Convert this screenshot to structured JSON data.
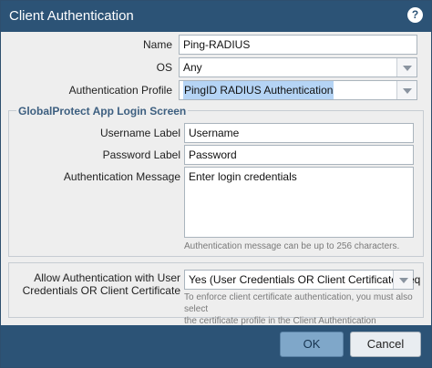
{
  "dialog": {
    "title": "Client Authentication",
    "help_icon": "?"
  },
  "form": {
    "name_label": "Name",
    "name_value": "Ping-RADIUS",
    "os_label": "OS",
    "os_value": "Any",
    "auth_profile_label": "Authentication Profile",
    "auth_profile_value": "PingID RADIUS Authentication"
  },
  "login_screen": {
    "group_title": "GlobalProtect App Login Screen",
    "username_label": "Username Label",
    "username_value": "Username",
    "password_label": "Password Label",
    "password_value": "Password",
    "message_label": "Authentication Message",
    "message_value": "Enter login credentials",
    "message_hint": "Authentication message can be up to 256 characters."
  },
  "cert_option": {
    "label_line1": "Allow Authentication with User",
    "label_line2": "Credentials OR Client Certificate",
    "value": "Yes (User Credentials OR Client Certificate Req",
    "hint_line1": "To enforce client certificate authentication, you must also select",
    "hint_line2": "the certificate profile in the Client Authentication configuration."
  },
  "footer": {
    "ok_label": "OK",
    "cancel_label": "Cancel"
  }
}
